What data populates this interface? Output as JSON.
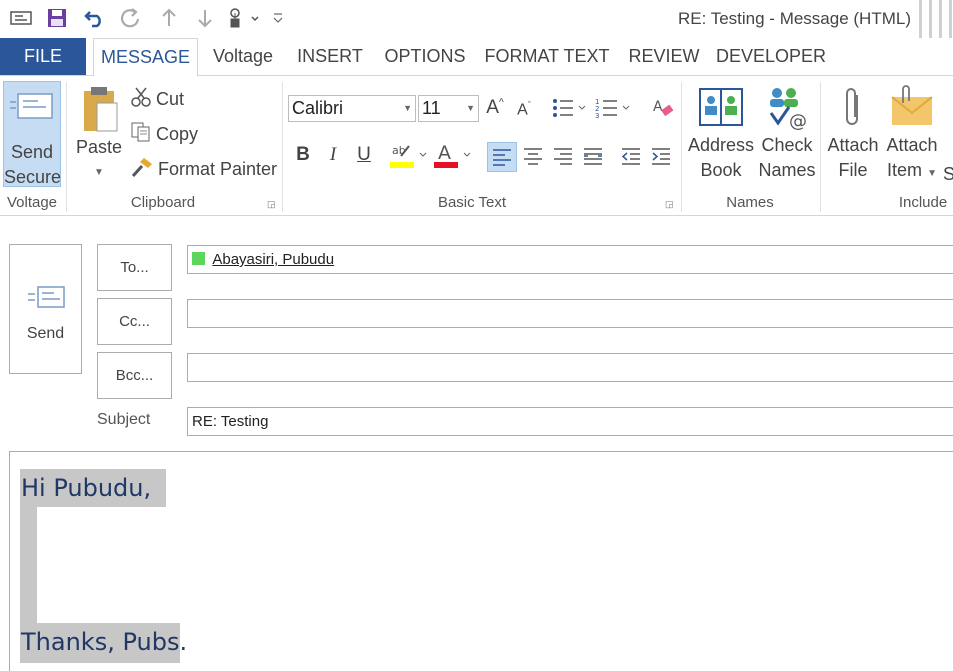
{
  "window": {
    "title": "RE: Testing - Message (HTML)"
  },
  "quick_access": [
    "email-icon",
    "save-icon",
    "undo-icon",
    "redo-icon",
    "up-arrow-icon",
    "down-arrow-icon",
    "touch-mode-icon",
    "customize-icon"
  ],
  "tabs": {
    "file": "FILE",
    "message": "MESSAGE",
    "voltage": "Voltage",
    "insert": "INSERT",
    "options": "OPTIONS",
    "format_text": "FORMAT TEXT",
    "review": "REVIEW",
    "developer": "DEVELOPER"
  },
  "ribbon": {
    "voltage_group": {
      "label": "Voltage",
      "send_secure_line1": "Send",
      "send_secure_line2": "Secure"
    },
    "clipboard": {
      "label": "Clipboard",
      "paste": "Paste",
      "cut": "Cut",
      "copy": "Copy",
      "format_painter": "Format Painter"
    },
    "basic_text": {
      "label": "Basic Text",
      "font": "Calibri",
      "size": "11",
      "bold": "B",
      "italic": "I",
      "underline": "U"
    },
    "names": {
      "label": "Names",
      "address_line1": "Address",
      "address_line2": "Book",
      "check_line1": "Check",
      "check_line2": "Names"
    },
    "include": {
      "label": "Include",
      "attach_file_line1": "Attach",
      "attach_file_line2": "File",
      "attach_item_line1": "Attach",
      "attach_item_line2": "Item",
      "signature_cut": "S"
    }
  },
  "compose": {
    "send": "Send",
    "to_button": "To...",
    "cc_button": "Cc...",
    "bcc_button": "Bcc...",
    "to_recipient": "Abayasiri, Pubudu",
    "cc_value": "",
    "bcc_value": "",
    "subject_label": "Subject",
    "subject_value": "RE: Testing"
  },
  "body": {
    "greeting": "Hi Pubudu,",
    "closing": "Thanks, Pubs."
  },
  "colors": {
    "accent": "#2b579a",
    "highlight": "#ffff00",
    "font_color": "#e81123",
    "presence": "#5cd65c",
    "selection": "#c7c7c7",
    "body_text": "#1f3864"
  }
}
